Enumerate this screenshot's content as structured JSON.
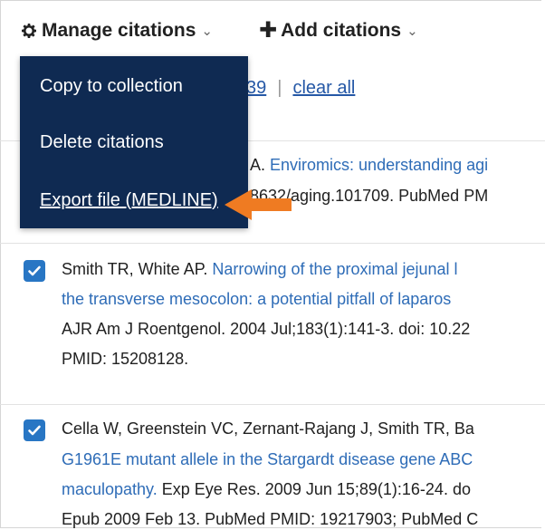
{
  "toolbar": {
    "manage_label": "Manage citations",
    "add_label": "Add citations"
  },
  "selection": {
    "count_fragment": "39",
    "separator": "|",
    "clear_label": "clear all"
  },
  "menu": {
    "items": [
      {
        "label": "Copy to collection"
      },
      {
        "label": "Delete citations"
      },
      {
        "label": "Export file (MEDLINE)"
      }
    ]
  },
  "citations": [
    {
      "line1_authors_fragment": "A.",
      "line1_title": "Enviromics: understanding agi",
      "line2": "8632/aging.101709. PubMed PM"
    },
    {
      "checked": true,
      "line1_authors": "Smith TR, White AP.",
      "line1_title": "Narrowing of the proximal jejunal l",
      "line2_title": "the transverse mesocolon: a potential pitfall of laparos",
      "line3": "AJR Am J Roentgenol. 2004 Jul;183(1):141-3. doi: 10.22",
      "line4": "PMID: 15208128."
    },
    {
      "checked": true,
      "line1_authors": "Cella W, Greenstein VC, Zernant-Rajang J, Smith TR, Ba",
      "line2_title": "G1961E mutant allele in the Stargardt disease gene ABC",
      "line3_title": "maculopathy.",
      "line3_rest": "Exp Eye Res. 2009 Jun 15;89(1):16-24. do",
      "line4": "Epub 2009 Feb 13. PubMed PMID: 19217903; PubMed C"
    }
  ],
  "colors": {
    "menu_bg": "#0f2a52",
    "link": "#2e6cb7",
    "checkbox": "#2876c4",
    "arrow": "#ef7b22"
  },
  "icons": [
    "gear-icon",
    "plus-icon",
    "chevron-down-icon",
    "checkbox-checked-icon",
    "arrow-left-icon"
  ]
}
